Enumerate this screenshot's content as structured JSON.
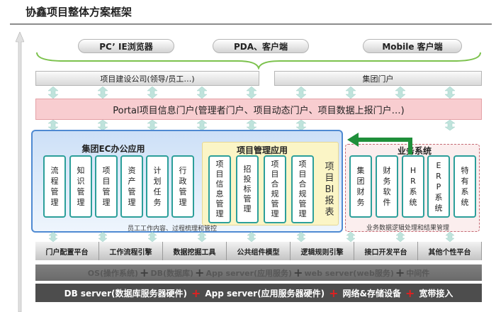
{
  "title": "协鑫项目整体方案框架",
  "clients": [
    "PC’ IE浏览器",
    "PDA、客户端",
    "Mobile 客户端"
  ],
  "portals": [
    "项目建设公司(领导/员工…)",
    "集团门户"
  ],
  "portal_bar": "Portal项目信息门户(管理者门户、项目动态门户、项目数据上报门户…)",
  "ec": {
    "title": "集团EC办公应用",
    "apps": [
      "流程管理",
      "知识管理",
      "项目管理",
      "资产管理",
      "计划任务",
      "行政管理"
    ],
    "note": "员工工作内容、过程梳理和管控"
  },
  "pm": {
    "title": "项目管理应用",
    "apps": [
      "项目信息管理",
      "招投标管理",
      "项目合规管理",
      "项目合规管理"
    ]
  },
  "bi_report": "项目BI报表",
  "biz": {
    "title": "业务系统",
    "apps": [
      "集团财务",
      "财务软件",
      "HR系统",
      "ERP系统",
      "特有系统"
    ],
    "note": "业务数据逻辑处理和结果管理"
  },
  "tools": [
    "门户配置平台",
    "工作流程引擎",
    "数据挖掘工具",
    "公共组件模型",
    "逻辑规则引擎",
    "接口开发平台",
    "其他个性平台"
  ],
  "os_bar": {
    "parts": [
      "OS(操作系统)",
      "DB(数据库)",
      "App server(应用服务)",
      "web server(web服务)",
      "中间件"
    ],
    "plus": "+"
  },
  "db_bar": {
    "parts": [
      "DB server(数据库服务器硬件)",
      "App server(应用服务器硬件)",
      "网络&存储设备",
      "宽带接入"
    ],
    "plus": "+"
  },
  "colors": {
    "teal": "#2c9f9a",
    "portal_pink": "#f8cdd0",
    "arrow": "#bfe3dc",
    "feedback_arrow": "#1f8f3a",
    "blue_border": "#4f8ad2"
  }
}
